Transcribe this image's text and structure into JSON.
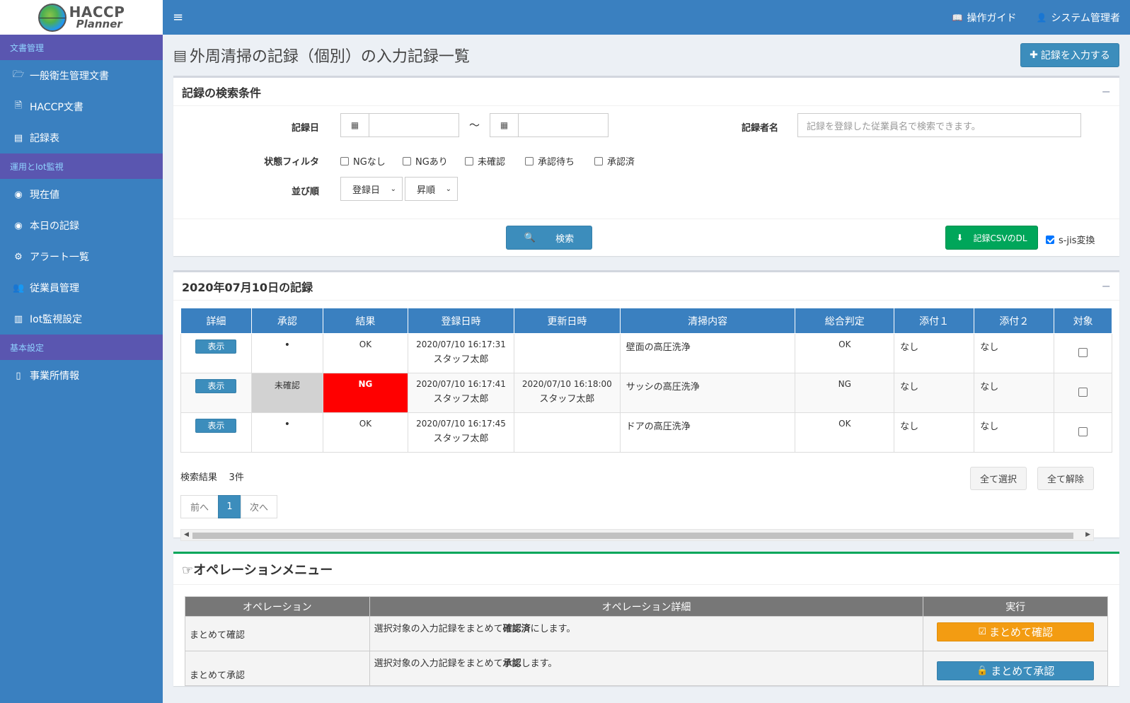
{
  "brand": {
    "line1": "HACCP",
    "line2": "Planner"
  },
  "topbar": {
    "guide_label": "操作ガイド",
    "user_label": "システム管理者"
  },
  "sidebar": {
    "sections": [
      {
        "header": "文書管理",
        "items": [
          "一般衛生管理文書",
          "HACCP文書",
          "記録表"
        ]
      },
      {
        "header": "運用とIot監視",
        "items": [
          "現在値",
          "本日の記録",
          "アラート一覧",
          "従業員管理",
          "Iot監視設定"
        ]
      },
      {
        "header": "基本設定",
        "items": [
          "事業所情報"
        ]
      }
    ]
  },
  "page": {
    "title": "外周清掃の記録（個別）の入力記録一覧",
    "add_button": "記録を入力する"
  },
  "search": {
    "title": "記録の検索条件",
    "collapse": "−",
    "date_label": "記録日",
    "tilde": "〜",
    "recorder_label": "記録者名",
    "recorder_placeholder": "記録を登録した従業員名で検索できます。",
    "status_label": "状態フィルタ",
    "status_options": [
      "NGなし",
      "NGあり",
      "未確認",
      "承認待ち",
      "承認済"
    ],
    "sort_label": "並び順",
    "sort_field": "登録日",
    "sort_order": "昇順",
    "search_button": "検索",
    "csv_button": "記録CSVのDL",
    "sjis_label": "s-jis変換"
  },
  "records": {
    "title": "2020年07月10日の記録",
    "collapse": "−",
    "columns": [
      "詳細",
      "承認",
      "結果",
      "登録日時",
      "更新日時",
      "清掃内容",
      "総合判定",
      "添付１",
      "添付２",
      "対象"
    ],
    "rows": [
      {
        "detail": "表示",
        "approval": "•",
        "result": "OK",
        "created": "2020/07/10 16:17:31",
        "created_by": "スタッフ太郎",
        "updated": "",
        "updated_by": "",
        "content": "壁面の高圧洗浄",
        "judgement": "OK",
        "att1": "なし",
        "att2": "なし"
      },
      {
        "detail": "表示",
        "approval": "未確認",
        "result": "NG",
        "created": "2020/07/10 16:17:41",
        "created_by": "スタッフ太郎",
        "updated": "2020/07/10 16:18:00",
        "updated_by": "スタッフ太郎",
        "content": "サッシの高圧洗浄",
        "judgement": "NG",
        "att1": "なし",
        "att2": "なし"
      },
      {
        "detail": "表示",
        "approval": "•",
        "result": "OK",
        "created": "2020/07/10 16:17:45",
        "created_by": "スタッフ太郎",
        "updated": "",
        "updated_by": "",
        "content": "ドアの高圧洗浄",
        "judgement": "OK",
        "att1": "なし",
        "att2": "なし"
      }
    ],
    "result_label": "検索結果",
    "result_count": "3件",
    "select_all": "全て選択",
    "deselect_all": "全て解除",
    "pager": {
      "prev": "前へ",
      "current": "1",
      "next": "次へ"
    }
  },
  "operations": {
    "title": "オペレーションメニュー",
    "columns": [
      "オペレーション",
      "オペレーション詳細",
      "実行"
    ],
    "rows": [
      {
        "name": "まとめて確認",
        "detail_pre": "選択対象の入力記録をまとめて",
        "detail_bold": "確認済",
        "detail_post": "にします。",
        "button": "まとめて確認"
      },
      {
        "name": "まとめて承認",
        "detail_pre": "選択対象の入力記録をまとめて",
        "detail_bold": "承認",
        "detail_post": "します。",
        "button": "まとめて承認"
      }
    ]
  },
  "colors": {
    "primary": "#3c8dbc",
    "sidebar": "#3a80c0",
    "section": "#5a56b0",
    "success": "#00a65a",
    "warning": "#f39c12",
    "danger": "#ff0000"
  }
}
